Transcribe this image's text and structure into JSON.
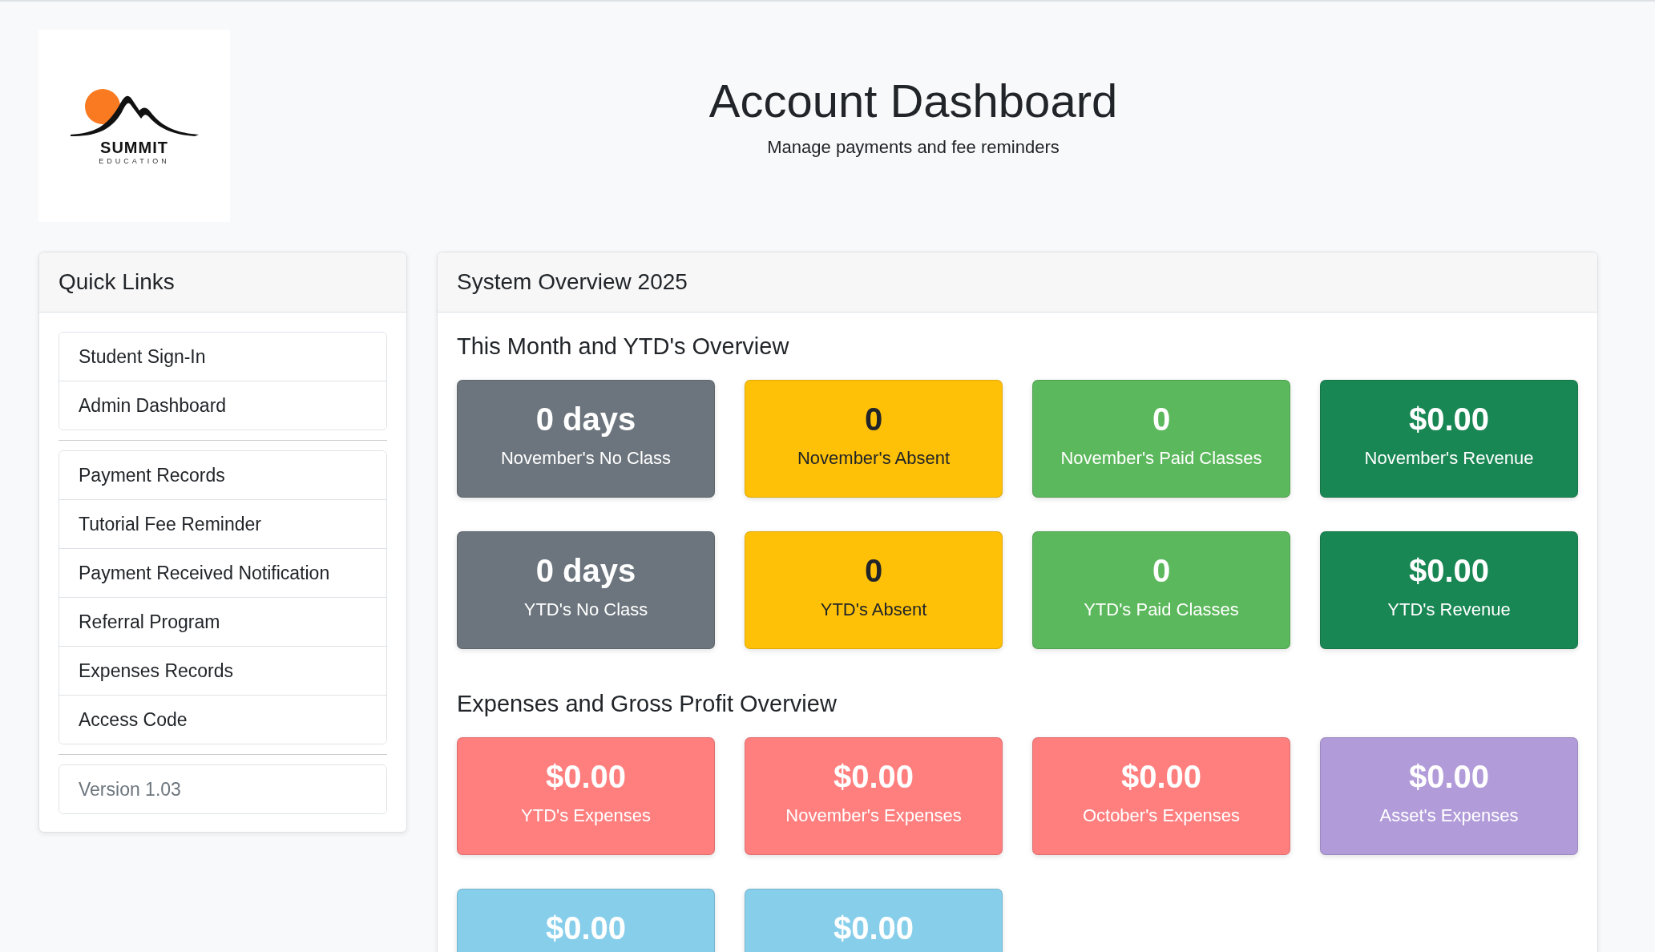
{
  "logo": {
    "name": "SUMMIT",
    "tagline": "EDUCATION"
  },
  "header": {
    "title": "Account Dashboard",
    "subtitle": "Manage payments and fee reminders"
  },
  "quick_links": {
    "title": "Quick Links",
    "groups": [
      [
        {
          "label": "Student Sign-In",
          "disabled": false
        },
        {
          "label": "Admin Dashboard",
          "disabled": false
        }
      ],
      [
        {
          "label": "Payment Records",
          "disabled": false
        },
        {
          "label": "Tutorial Fee Reminder",
          "disabled": false
        },
        {
          "label": "Payment Received Notification",
          "disabled": false
        },
        {
          "label": "Referral Program",
          "disabled": false
        },
        {
          "label": "Expenses Records",
          "disabled": false
        },
        {
          "label": "Access Code",
          "disabled": false
        }
      ],
      [
        {
          "label": "Version 1.03",
          "disabled": true
        }
      ]
    ]
  },
  "overview": {
    "title": "System Overview 2025",
    "sections": [
      {
        "title": "This Month and YTD's Overview",
        "cards": [
          {
            "value": "0 days",
            "label": "November's No Class",
            "color": "#6c757d",
            "dark_text": false
          },
          {
            "value": "0",
            "label": "November's Absent",
            "color": "#ffc107",
            "dark_text": true
          },
          {
            "value": "0",
            "label": "November's Paid Classes",
            "color": "#5cb85c",
            "dark_text": false
          },
          {
            "value": "$0.00",
            "label": "November's Revenue",
            "color": "#198754",
            "dark_text": false
          },
          {
            "value": "0 days",
            "label": "YTD's No Class",
            "color": "#6c757d",
            "dark_text": false
          },
          {
            "value": "0",
            "label": "YTD's Absent",
            "color": "#ffc107",
            "dark_text": true
          },
          {
            "value": "0",
            "label": "YTD's Paid Classes",
            "color": "#5cb85c",
            "dark_text": false
          },
          {
            "value": "$0.00",
            "label": "YTD's Revenue",
            "color": "#198754",
            "dark_text": false
          }
        ]
      },
      {
        "title": "Expenses and Gross Profit Overview",
        "cards": [
          {
            "value": "$0.00",
            "label": "YTD's Expenses",
            "color": "#ff7f7f",
            "dark_text": false
          },
          {
            "value": "$0.00",
            "label": "November's Expenses",
            "color": "#ff7f7f",
            "dark_text": false
          },
          {
            "value": "$0.00",
            "label": "October's Expenses",
            "color": "#ff7f7f",
            "dark_text": false
          },
          {
            "value": "$0.00",
            "label": "Asset's Expenses",
            "color": "#b19cd9",
            "dark_text": false
          },
          {
            "value": "$0.00",
            "color": "#87ceeb",
            "dark_text": false
          },
          {
            "value": "$0.00",
            "color": "#87ceeb",
            "dark_text": false
          }
        ]
      }
    ]
  }
}
